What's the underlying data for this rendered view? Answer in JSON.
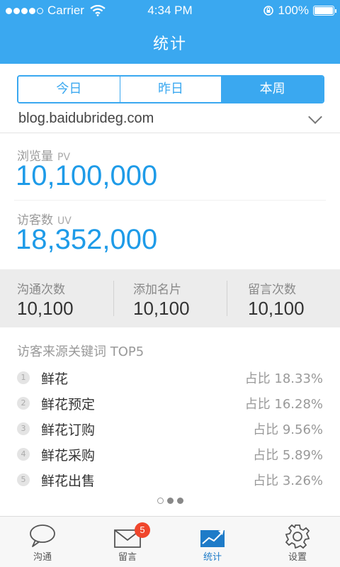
{
  "status_bar": {
    "carrier": "Carrier",
    "time": "4:34 PM",
    "battery": "100%"
  },
  "header": {
    "title": "统计"
  },
  "segmented": {
    "items": [
      {
        "label": "今日"
      },
      {
        "label": "昨日"
      },
      {
        "label": "本周"
      }
    ],
    "active_index": 2
  },
  "site": {
    "domain": "blog.baidubrideg.com"
  },
  "metrics": {
    "pv": {
      "label": "浏览量",
      "unit": "PV",
      "value": "10,100,000"
    },
    "uv": {
      "label": "访客数",
      "unit": "UV",
      "value": "18,352,000"
    }
  },
  "summary": [
    {
      "label": "沟通次数",
      "value": "10,100"
    },
    {
      "label": "添加名片",
      "value": "10,100"
    },
    {
      "label": "留言次数",
      "value": "10,100"
    }
  ],
  "keywords": {
    "title": "访客来源关键词 TOP5",
    "items": [
      {
        "rank": "1",
        "name": "鲜花",
        "share": "占比 18.33%"
      },
      {
        "rank": "2",
        "name": "鲜花预定",
        "share": "占比 16.28%"
      },
      {
        "rank": "3",
        "name": "鲜花订购",
        "share": "占比 9.56%"
      },
      {
        "rank": "4",
        "name": "鲜花采购",
        "share": "占比 5.89%"
      },
      {
        "rank": "5",
        "name": "鲜花出售",
        "share": "占比 3.26%"
      }
    ]
  },
  "pager": {
    "count": 3,
    "current": 0
  },
  "tabbar": {
    "items": [
      {
        "label": "沟通",
        "icon": "chat-bubble-icon"
      },
      {
        "label": "留言",
        "icon": "envelope-icon",
        "badge": "5"
      },
      {
        "label": "统计",
        "icon": "chart-icon"
      },
      {
        "label": "设置",
        "icon": "gear-icon"
      }
    ],
    "active_index": 2
  },
  "colors": {
    "accent": "#3aa8f0",
    "value_blue": "#1e9be8",
    "badge_red": "#f0462c"
  }
}
